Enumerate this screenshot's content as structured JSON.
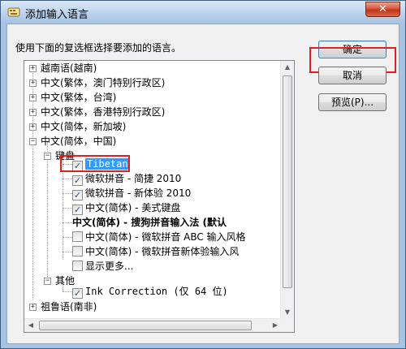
{
  "window": {
    "title": "添加输入语言",
    "close_label": "✕"
  },
  "instruction": "使用下面的复选框选择要添加的语言。",
  "buttons": {
    "ok": "确定",
    "cancel": "取消",
    "preview": "预览(P)..."
  },
  "tree": {
    "languages": [
      {
        "label": "越南语(越南)",
        "expander": "+"
      },
      {
        "label": "中文(繁体，澳门特别行政区)",
        "expander": "+"
      },
      {
        "label": "中文(繁体，台湾)",
        "expander": "+"
      },
      {
        "label": "中文(繁体，香港特别行政区)",
        "expander": "+"
      },
      {
        "label": "中文(简体，新加坡)",
        "expander": "+"
      },
      {
        "label": "中文(简体，中国)",
        "expander": "−"
      }
    ],
    "keyboard_group": {
      "label": "键盘",
      "expander": "−"
    },
    "keyboards": [
      {
        "label": "Tibetan",
        "checked": true,
        "selected": true
      },
      {
        "label": "微软拼音 - 简捷 2010",
        "checked": true
      },
      {
        "label": "微软拼音 - 新体验 2010",
        "checked": true
      },
      {
        "label": "中文(简体) - 美式键盘",
        "checked": true
      },
      {
        "label": "中文(简体) - 搜狗拼音输入法 (默认",
        "checked": null,
        "bold": true
      },
      {
        "label": "中文(简体) - 微软拼音 ABC 输入风格",
        "checked": false
      },
      {
        "label": "中文(简体) - 微软拼音新体验输入风",
        "checked": false
      },
      {
        "label": "显示更多...",
        "checked": false
      }
    ],
    "other_group": {
      "label": "其他",
      "expander": "−"
    },
    "other_items": [
      {
        "label": "Ink Correction (仅 64 位)",
        "checked": true
      }
    ],
    "last_language": {
      "label": "祖鲁语(南非)",
      "expander": "+"
    },
    "check_mark": "✓"
  },
  "colors": {
    "highlight_box": "#e02020",
    "selection": "#3399ff"
  }
}
